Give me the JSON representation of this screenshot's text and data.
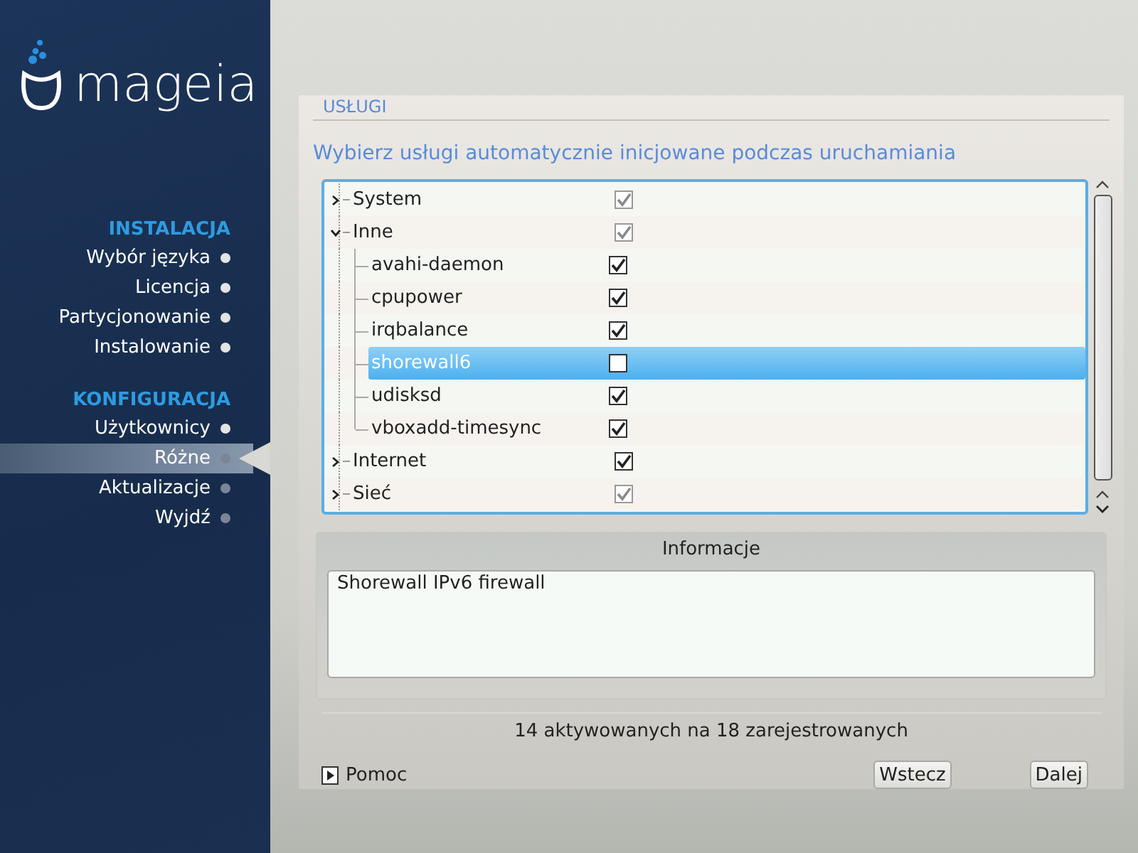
{
  "logo": {
    "text": "mageia"
  },
  "sidebar": {
    "sections": [
      {
        "title": "INSTALACJA",
        "items": [
          {
            "label": "Wybór języka",
            "done": true,
            "selected": false
          },
          {
            "label": "Licencja",
            "done": true,
            "selected": false
          },
          {
            "label": "Partycjonowanie",
            "done": true,
            "selected": false
          },
          {
            "label": "Instalowanie",
            "done": true,
            "selected": false
          }
        ]
      },
      {
        "title": "KONFIGURACJA",
        "items": [
          {
            "label": "Użytkownicy",
            "done": true,
            "selected": false
          },
          {
            "label": "Różne",
            "done": false,
            "selected": true
          },
          {
            "label": "Aktualizacje",
            "done": false,
            "selected": false
          },
          {
            "label": "Wyjdź",
            "done": false,
            "selected": false
          }
        ]
      }
    ]
  },
  "page": {
    "title": "USŁUGI",
    "instruction": "Wybierz usługi automatycznie inicjowane podczas uruchamiania"
  },
  "services": [
    {
      "name": "System",
      "expanded": false,
      "checked": true,
      "inconsistent": true,
      "selected": false
    },
    {
      "name": "Inne",
      "expanded": true,
      "checked": true,
      "inconsistent": true,
      "selected": false,
      "children": [
        {
          "name": "avahi-daemon",
          "checked": true,
          "selected": false
        },
        {
          "name": "cpupower",
          "checked": true,
          "selected": false
        },
        {
          "name": "irqbalance",
          "checked": true,
          "selected": false
        },
        {
          "name": "shorewall6",
          "checked": false,
          "selected": true
        },
        {
          "name": "udisksd",
          "checked": true,
          "selected": false
        },
        {
          "name": "vboxadd-timesync",
          "checked": true,
          "selected": false
        }
      ]
    },
    {
      "name": "Internet",
      "expanded": false,
      "checked": true,
      "inconsistent": false,
      "selected": false
    },
    {
      "name": "Sieć",
      "expanded": false,
      "checked": true,
      "inconsistent": true,
      "selected": false
    }
  ],
  "info": {
    "title": "Informacje",
    "text": "Shorewall IPv6 firewall"
  },
  "status": "14 aktywowanych na 18 zarejestrowanych",
  "help": {
    "label": "Pomoc",
    "expanded": false
  },
  "buttons": [
    {
      "label": "Wstecz"
    },
    {
      "label": "Dalej"
    }
  ]
}
